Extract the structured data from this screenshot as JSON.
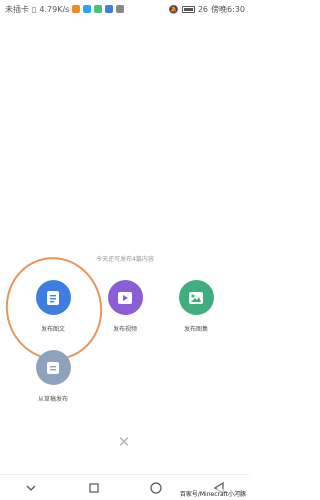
{
  "status_bar": {
    "carrier": "未插卡",
    "speed": "4.79K/s",
    "battery_pct": "26",
    "time": "傍晚6:30"
  },
  "hint": "今天还可发布4篇内容",
  "actions": [
    {
      "label": "发布图文",
      "color": "#3d7ee0",
      "icon": "document-icon"
    },
    {
      "label": "发布视频",
      "color": "#8a5fd6",
      "icon": "video-play-icon"
    },
    {
      "label": "发布图集",
      "color": "#3fae7e",
      "icon": "image-icon"
    },
    {
      "label": "从草稿发布",
      "color": "#8fa2bd",
      "icon": "draft-icon"
    }
  ],
  "close_icon": "close-icon",
  "watermark": "百家号/Minecraft小河豚",
  "colors": {
    "annotation": "#e8955a",
    "hint_text": "#9a9a9a"
  }
}
